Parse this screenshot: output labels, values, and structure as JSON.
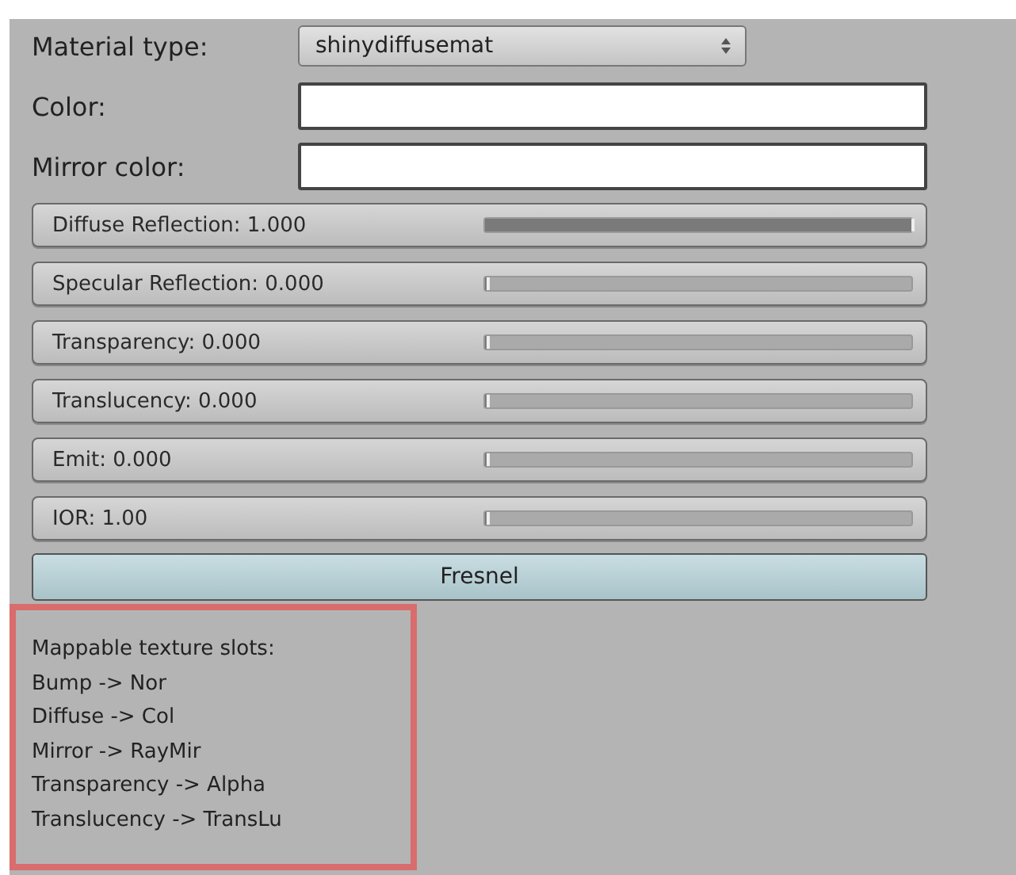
{
  "material_type": {
    "label": "Material type:",
    "value": "shinydiffusemat"
  },
  "color_fields": [
    {
      "label": "Color:"
    },
    {
      "label": "Mirror color:"
    }
  ],
  "sliders": [
    {
      "label": "Diffuse Reflection: 1.000",
      "level": 1
    },
    {
      "label": "Specular Reflection: 0.000",
      "level": 0
    },
    {
      "label": "Transparency: 0.000",
      "level": 0
    },
    {
      "label": "Translucency: 0.000",
      "level": 0
    },
    {
      "label": "Emit: 0.000",
      "level": 0
    },
    {
      "label": "IOR: 1.00",
      "level": 0
    }
  ],
  "fresnel_button": {
    "label": "Fresnel"
  },
  "texture_slots": {
    "title": "Mappable texture slots:",
    "lines": [
      "Bump -> Nor",
      "Diffuse -> Col",
      "Mirror -> RayMir",
      "Transparency -> Alpha",
      "Translucency -> TransLu"
    ]
  }
}
